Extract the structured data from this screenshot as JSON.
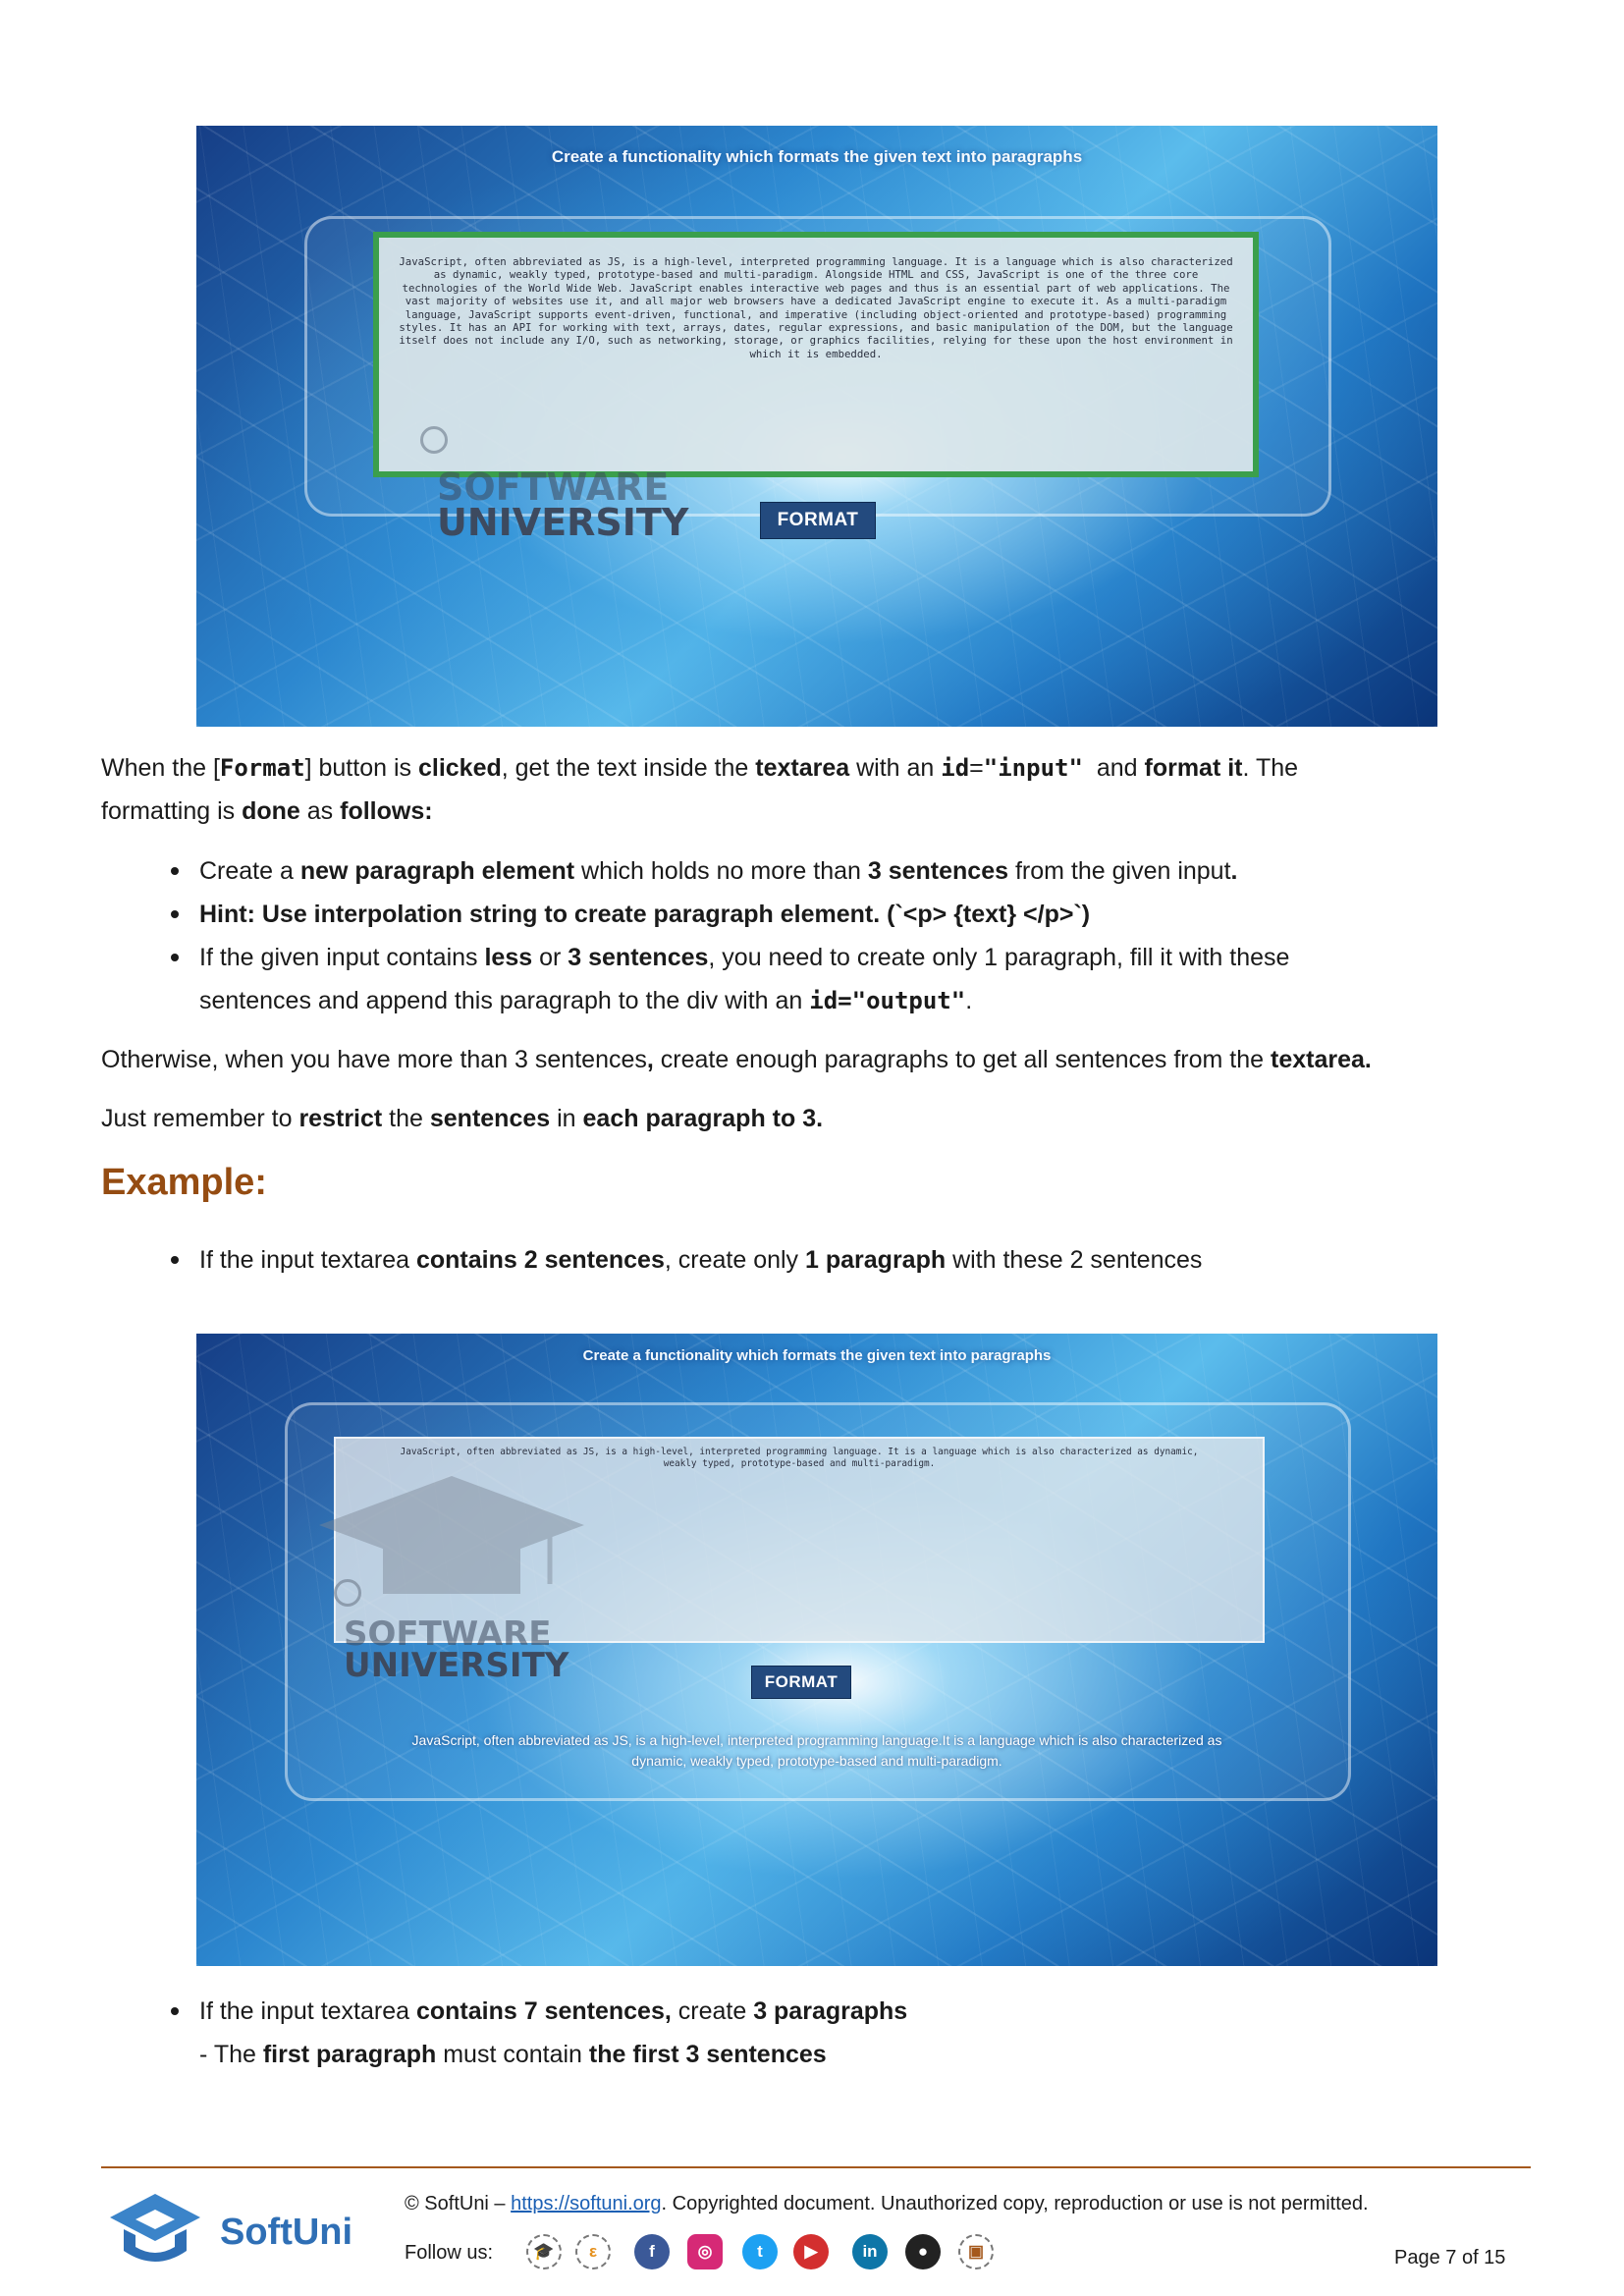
{
  "screenshot1": {
    "app_title": "Create a functionality which formats the given text into paragraphs",
    "textarea_text": "JavaScript, often abbreviated as JS, is a high-level, interpreted programming language. It is a language which is also characterized as dynamic, weakly typed, prototype-based and multi-paradigm. Alongside HTML and CSS, JavaScript is one of the three core technologies of the World Wide Web. JavaScript enables interactive web pages and thus is an essential part of web applications. The vast majority of websites use it, and all major web browsers have a dedicated JavaScript engine to execute it. As a multi-paradigm language, JavaScript supports event-driven, functional, and imperative (including object-oriented and prototype-based) programming styles. It has an API for working with text, arrays, dates, regular expressions, and basic manipulation of the DOM, but the language itself does not include any I/O, such as networking, storage, or graphics facilities, relying for these upon the host environment in which it is embedded.",
    "logo_line1": "SOFTWARE",
    "logo_line2": "UNIVERSITY",
    "button_label": "FORMAT"
  },
  "para1": {
    "t1": "When the [",
    "code1": "Format",
    "t2": "] button is ",
    "b1": "clicked",
    "t3": ", get the text inside the ",
    "b2": "textarea",
    "t4": " with an ",
    "code2": "id",
    "t5": "=",
    "code3": "\"input\"",
    "t6": "  and ",
    "b3": "format it",
    "t7": ". The",
    "t8": "formatting is ",
    "b4": "done",
    "t9": " as ",
    "b5": "follows:"
  },
  "bullets": {
    "b1": {
      "t1": "Create a ",
      "b1": "new paragraph element",
      "t2": " which holds no more than ",
      "b2": "3 sentences",
      "t3": " from the given input",
      "b3": "."
    },
    "b2": {
      "b1": "Hint: Use interpolation string to create paragraph element. (`<p> {text} </p>`)"
    },
    "b3": {
      "t1": "If the given input contains ",
      "b1": "less",
      "t2": " or ",
      "b2": "3 sentences",
      "t3": ", you need to create only 1 paragraph, fill it with these",
      "t4": "sentences and append this paragraph to the div with an ",
      "code1": "id=\"output\"",
      "t5": "."
    }
  },
  "para2": {
    "t1": "Otherwise, when you have more than 3 sentences",
    "b1": ",",
    "t2": " create enough paragraphs to get all sentences from the ",
    "b2": "textarea."
  },
  "para3": {
    "t1": "Just remember to ",
    "b1": "restrict",
    "t2": " the ",
    "b2": "sentences",
    "t3": " in ",
    "b3": "each paragraph to 3."
  },
  "example_heading": "Example:",
  "bullet4": {
    "t1": "If the input textarea ",
    "b1": "contains 2 sentences",
    "t2": ", create only ",
    "b2": "1 paragraph",
    "t3": " with these 2 sentences"
  },
  "screenshot2": {
    "app_title": "Create a functionality which formats the given text into paragraphs",
    "textarea_text": "JavaScript, often abbreviated as JS, is a high-level, interpreted programming language. It is a language which is also characterized as dynamic, weakly typed, prototype-based and multi-paradigm.",
    "logo_line1": "SOFTWARE",
    "logo_line2": "UNIVERSITY",
    "button_label": "FORMAT",
    "output_line1": "JavaScript, often abbreviated as JS, is a high-level, interpreted programming language.It is a language which is also characterized as",
    "output_line2": "dynamic, weakly typed, prototype-based and multi-paradigm."
  },
  "bullet5": {
    "t1": "If the input textarea ",
    "b1": "contains 7 sentences,",
    "t2": " create ",
    "b2": "3 paragraphs",
    "t3": "- The ",
    "b3": "first paragraph",
    "t4": " must contain ",
    "b4": "the first 3 sentences"
  },
  "footer": {
    "copyright_prefix": "© SoftUni – ",
    "link": "https://softuni.org",
    "copyright_suffix": ". Copyrighted document. Unauthorized copy, reproduction or use is not permitted.",
    "follow_us": "Follow us:",
    "brand": "SoftUni",
    "page": "Page 7 of 15",
    "social_icons": [
      "softuni-hat-icon",
      "softuni-creative-icon",
      "facebook-icon",
      "instagram-icon",
      "twitter-icon",
      "youtube-icon",
      "linkedin-icon",
      "github-icon",
      "softuni-digital-icon"
    ],
    "colors": {
      "accent": "#a5581c",
      "heading": "#954c12",
      "brand_blue": "#2f6fb5"
    }
  }
}
